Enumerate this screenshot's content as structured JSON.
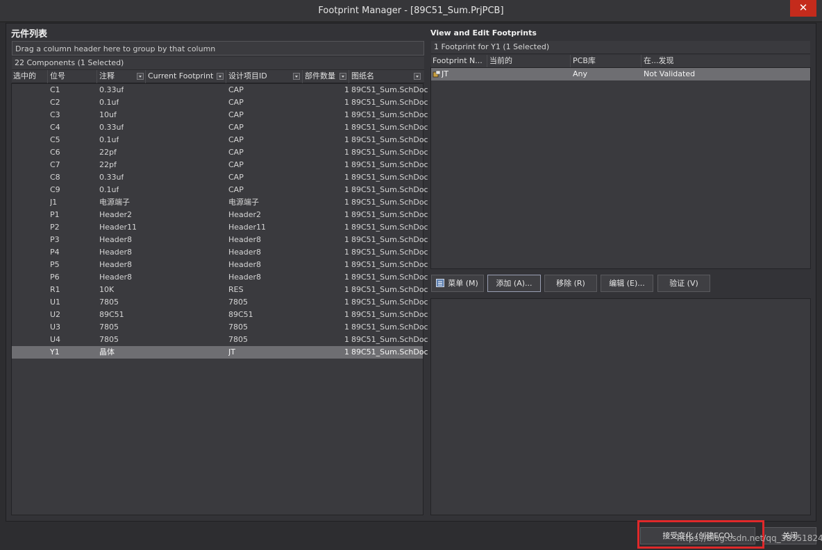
{
  "window": {
    "title": "Footprint Manager - [89C51_Sum.PrjPCB]",
    "close_glyph": "✕"
  },
  "left": {
    "section_title": "元件列表",
    "group_hint": "Drag a column header here to group by that column",
    "count_text": "22 Components (1 Selected)",
    "columns": [
      "选中的",
      "位号",
      "注释",
      "Current Footprint",
      "设计项目ID",
      "部件数量",
      "图纸名"
    ],
    "rows": [
      {
        "designator": "C1",
        "comment": "0.33uf",
        "footprint": "",
        "design_id": "CAP",
        "parts": "1",
        "sheet": "89C51_Sum.SchDoc"
      },
      {
        "designator": "C2",
        "comment": "0.1uf",
        "footprint": "",
        "design_id": "CAP",
        "parts": "1",
        "sheet": "89C51_Sum.SchDoc"
      },
      {
        "designator": "C3",
        "comment": "10uf",
        "footprint": "",
        "design_id": "CAP",
        "parts": "1",
        "sheet": "89C51_Sum.SchDoc"
      },
      {
        "designator": "C4",
        "comment": "0.33uf",
        "footprint": "",
        "design_id": "CAP",
        "parts": "1",
        "sheet": "89C51_Sum.SchDoc"
      },
      {
        "designator": "C5",
        "comment": "0.1uf",
        "footprint": "",
        "design_id": "CAP",
        "parts": "1",
        "sheet": "89C51_Sum.SchDoc"
      },
      {
        "designator": "C6",
        "comment": "22pf",
        "footprint": "",
        "design_id": "CAP",
        "parts": "1",
        "sheet": "89C51_Sum.SchDoc"
      },
      {
        "designator": "C7",
        "comment": "22pf",
        "footprint": "",
        "design_id": "CAP",
        "parts": "1",
        "sheet": "89C51_Sum.SchDoc"
      },
      {
        "designator": "C8",
        "comment": "0.33uf",
        "footprint": "",
        "design_id": "CAP",
        "parts": "1",
        "sheet": "89C51_Sum.SchDoc"
      },
      {
        "designator": "C9",
        "comment": "0.1uf",
        "footprint": "",
        "design_id": "CAP",
        "parts": "1",
        "sheet": "89C51_Sum.SchDoc"
      },
      {
        "designator": "J1",
        "comment": "电源端子",
        "footprint": "",
        "design_id": "电源端子",
        "parts": "1",
        "sheet": "89C51_Sum.SchDoc"
      },
      {
        "designator": "P1",
        "comment": "Header2",
        "footprint": "",
        "design_id": "Header2",
        "parts": "1",
        "sheet": "89C51_Sum.SchDoc"
      },
      {
        "designator": "P2",
        "comment": "Header11",
        "footprint": "",
        "design_id": "Header11",
        "parts": "1",
        "sheet": "89C51_Sum.SchDoc"
      },
      {
        "designator": "P3",
        "comment": "Header8",
        "footprint": "",
        "design_id": "Header8",
        "parts": "1",
        "sheet": "89C51_Sum.SchDoc"
      },
      {
        "designator": "P4",
        "comment": "Header8",
        "footprint": "",
        "design_id": "Header8",
        "parts": "1",
        "sheet": "89C51_Sum.SchDoc"
      },
      {
        "designator": "P5",
        "comment": "Header8",
        "footprint": "",
        "design_id": "Header8",
        "parts": "1",
        "sheet": "89C51_Sum.SchDoc"
      },
      {
        "designator": "P6",
        "comment": "Header8",
        "footprint": "",
        "design_id": "Header8",
        "parts": "1",
        "sheet": "89C51_Sum.SchDoc"
      },
      {
        "designator": "R1",
        "comment": "10K",
        "footprint": "",
        "design_id": "RES",
        "parts": "1",
        "sheet": "89C51_Sum.SchDoc"
      },
      {
        "designator": "U1",
        "comment": "7805",
        "footprint": "",
        "design_id": "7805",
        "parts": "1",
        "sheet": "89C51_Sum.SchDoc"
      },
      {
        "designator": "U2",
        "comment": "89C51",
        "footprint": "",
        "design_id": "89C51",
        "parts": "1",
        "sheet": "89C51_Sum.SchDoc"
      },
      {
        "designator": "U3",
        "comment": "7805",
        "footprint": "",
        "design_id": "7805",
        "parts": "1",
        "sheet": "89C51_Sum.SchDoc"
      },
      {
        "designator": "U4",
        "comment": "7805",
        "footprint": "",
        "design_id": "7805",
        "parts": "1",
        "sheet": "89C51_Sum.SchDoc"
      },
      {
        "designator": "Y1",
        "comment": "晶体",
        "footprint": "",
        "design_id": "JT",
        "parts": "1",
        "sheet": "89C51_Sum.SchDoc",
        "selected": true
      }
    ]
  },
  "right": {
    "section_title": "View and Edit Footprints",
    "count_text": "1 Footprint for Y1 (1 Selected)",
    "columns": [
      "Footprint N...",
      "当前的",
      "PCB库",
      "在...发现"
    ],
    "rows": [
      {
        "name": "JT",
        "current": "",
        "library": "Any",
        "found_in": "Not Validated",
        "selected": true
      }
    ],
    "buttons": {
      "menu": "菜单 (M)",
      "add": "添加 (A)...",
      "remove": "移除 (R)",
      "edit": "编辑 (E)...",
      "validate": "验证 (V)"
    }
  },
  "footer": {
    "accept": "接受变化 (创建ECO)",
    "close": "关闭",
    "watermark": "https://blog.csdn.net/qq_38351824"
  },
  "colors": {
    "highlight_box": "#e0282a",
    "close_button": "#c42b1c",
    "selected_row": "#6e6e72"
  }
}
